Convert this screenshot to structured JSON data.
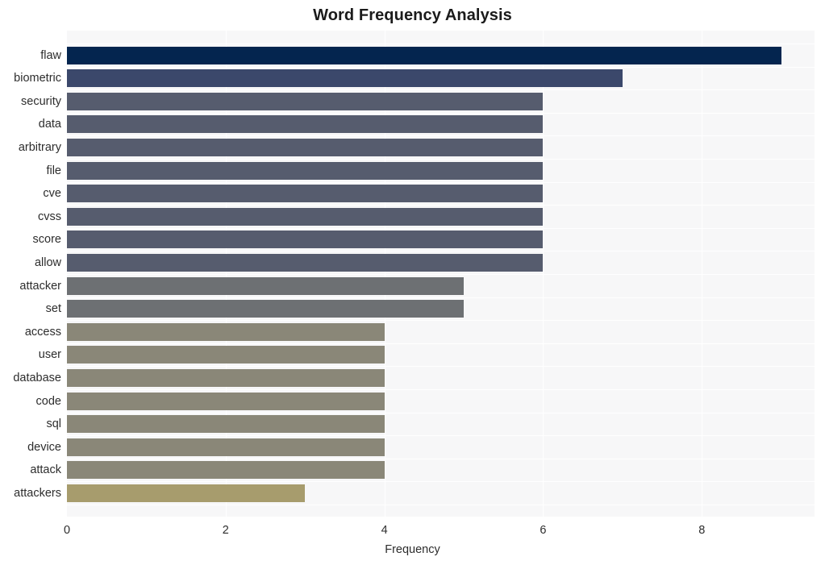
{
  "chart_data": {
    "type": "bar",
    "orientation": "horizontal",
    "title": "Word Frequency Analysis",
    "xlabel": "Frequency",
    "ylabel": "",
    "xlim": [
      0,
      9.42
    ],
    "xticks": [
      0,
      2,
      4,
      6,
      8
    ],
    "xtick_labels": [
      "0",
      "2",
      "4",
      "6",
      "8"
    ],
    "grid": true,
    "legend": "none",
    "plot_background": "#f7f7f8",
    "categories": [
      "flaw",
      "biometric",
      "security",
      "data",
      "arbitrary",
      "file",
      "cve",
      "cvss",
      "score",
      "allow",
      "attacker",
      "set",
      "access",
      "user",
      "database",
      "code",
      "sql",
      "device",
      "attack",
      "attackers"
    ],
    "values": [
      9,
      7,
      6,
      6,
      6,
      6,
      6,
      6,
      6,
      6,
      5,
      5,
      4,
      4,
      4,
      4,
      4,
      4,
      4,
      3
    ],
    "bar_colors": [
      "#04254f",
      "#3b486b",
      "#565c6e",
      "#565c6e",
      "#565c6e",
      "#565c6e",
      "#565c6e",
      "#565c6e",
      "#565c6e",
      "#565c6e",
      "#6d7073",
      "#6d7073",
      "#8a8778",
      "#8a8778",
      "#8a8778",
      "#8a8778",
      "#8a8778",
      "#8a8778",
      "#8a8778",
      "#a79c6d"
    ]
  }
}
